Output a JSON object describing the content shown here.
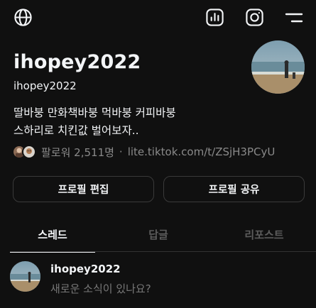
{
  "header": {
    "icons": [
      "globe-icon",
      "insights-icon",
      "instagram-icon",
      "menu-icon"
    ]
  },
  "profile": {
    "display_name": "ihopey2022",
    "handle": "ihopey2022",
    "bio": "딸바붕 만화책바붕 먹바붕 커피바붕\n스하리로 치킨값 벌어보자..",
    "followers_label": "팔로워 2,511명",
    "separator": "·",
    "link": "lite.tiktok.com/t/ZSjH3PCyU"
  },
  "actions": {
    "edit_profile": "프로필 편집",
    "share_profile": "프로필 공유"
  },
  "tabs": [
    {
      "label": "스레드",
      "active": true
    },
    {
      "label": "답글",
      "active": false
    },
    {
      "label": "리포스트",
      "active": false
    }
  ],
  "composer": {
    "username": "ihopey2022",
    "placeholder": "새로운 소식이 있나요?"
  },
  "colors": {
    "background": "#101010",
    "text": "#f3f5f7",
    "muted": "#8a8a8a",
    "border": "#3a3a3a",
    "inactive_tab": "#5c5c5c"
  }
}
